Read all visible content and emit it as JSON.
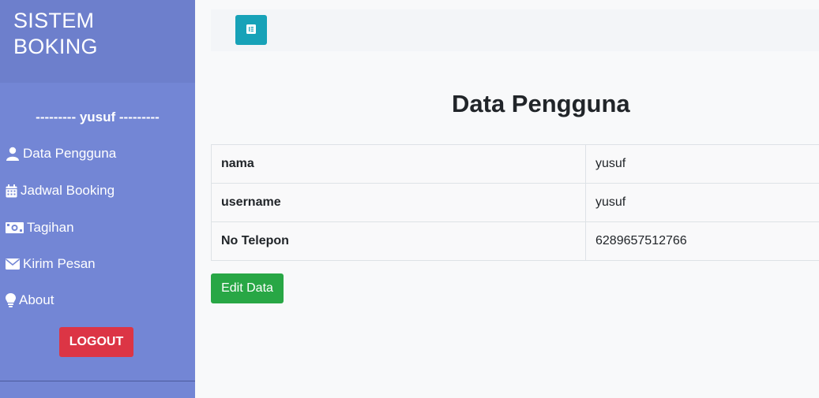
{
  "sidebar": {
    "brand": "SISTEM BOKING",
    "user_line": "--------- yusuf ---------",
    "items": [
      {
        "label": "Data Pengguna",
        "icon": "user-icon"
      },
      {
        "label": "Jadwal Booking",
        "icon": "calendar-icon"
      },
      {
        "label": "Tagihan",
        "icon": "money-bill-icon"
      },
      {
        "label": "Kirim Pesan",
        "icon": "envelope-icon"
      },
      {
        "label": "About",
        "icon": "lightbulb-icon"
      }
    ],
    "logout_label": "LOGOUT"
  },
  "topbar": {
    "toggle_icon": "align-left-icon"
  },
  "main": {
    "title": "Data Pengguna",
    "rows": [
      {
        "key": "nama",
        "value": "yusuf"
      },
      {
        "key": "username",
        "value": "yusuf"
      },
      {
        "key": "No Telepon",
        "value": "6289657512766"
      }
    ],
    "edit_label": "Edit Data"
  },
  "colors": {
    "sidebar": "#7386d5",
    "sidebar_header": "#6d7fcc",
    "toggle": "#17a2b8",
    "logout": "#dc3545",
    "edit": "#28a745"
  }
}
